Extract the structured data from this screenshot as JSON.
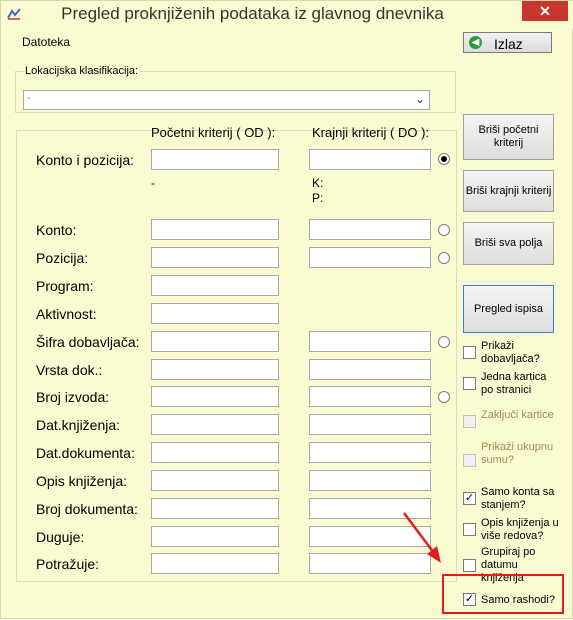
{
  "window": {
    "title": "Pregled proknjiženih podataka iz glavnog dnevnika",
    "close_symbol": "✕"
  },
  "menu": {
    "file": "Datoteka",
    "exit": "Izlaz"
  },
  "lokacija": {
    "label": "Lokacijska klasifikacija:",
    "value": "-"
  },
  "criteria": {
    "from_header": "Početni kriterij ( OD ):",
    "to_header": "Krajnji kriterij ( DO ):"
  },
  "konto_pozicija": {
    "label": "Konto i pozicija:",
    "from_note": "-",
    "to_note_k": "K:",
    "to_note_p": "P:"
  },
  "fields": [
    "Konto:",
    "Pozicija:",
    "Program:",
    "Aktivnost:",
    "Šifra dobavljača:",
    "Vrsta dok.:",
    "Broj izvoda:",
    "Dat.knjiženja:",
    "Dat.dokumenta:",
    "Opis knjiženja:",
    "Broj dokumenta:",
    "Duguje:",
    "Potražuje:"
  ],
  "buttons": {
    "clear_start": "Briši početni kriterij",
    "clear_end": "Briši krajnji kriterij",
    "clear_all": "Briši sva polja",
    "preview": "Pregled ispisa"
  },
  "options": [
    {
      "label": "Prikaži dobavljača?",
      "checked": false,
      "enabled": true
    },
    {
      "label": "Jedna kartica po stranici",
      "checked": false,
      "enabled": true
    },
    {
      "label": "Zaključi kartice",
      "checked": false,
      "enabled": false
    },
    {
      "label": "Prikaži ukupnu sumu?",
      "checked": false,
      "enabled": false
    },
    {
      "label": "Samo konta sa stanjem?",
      "checked": true,
      "enabled": true
    },
    {
      "label": "Opis knjiženja u više redova?",
      "checked": false,
      "enabled": true
    },
    {
      "label": "Grupiraj po datumu knjiženja",
      "checked": false,
      "enabled": true
    },
    {
      "label": "Samo rashodi?",
      "checked": true,
      "enabled": true
    }
  ],
  "colors": {
    "background": "#fbfbd2",
    "highlight": "#e51c1c",
    "close": "#c7372f"
  },
  "icons": {
    "exit": "green-back-arrow-icon",
    "app": "app-logo-icon"
  }
}
